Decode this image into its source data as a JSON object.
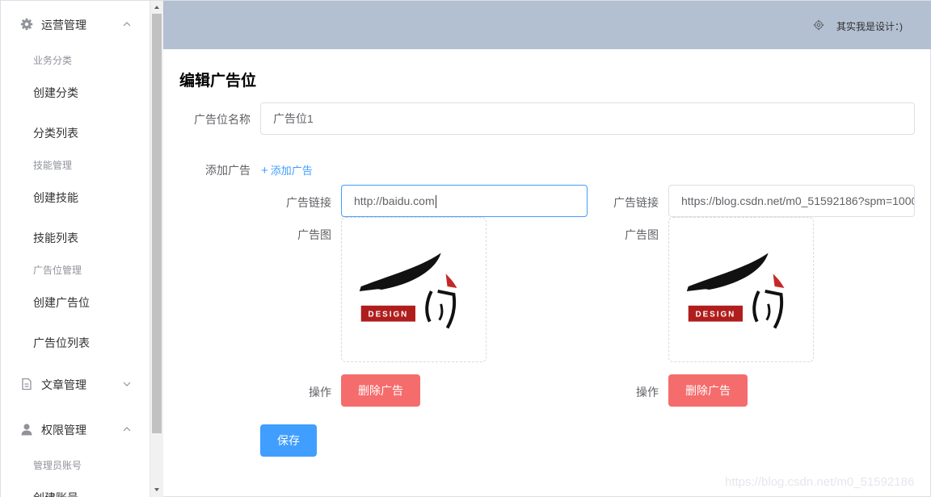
{
  "sidebar": {
    "groups": [
      {
        "title": "运营管理",
        "icon": "gear-icon",
        "expanded": true
      },
      {
        "title": "文章管理",
        "icon": "document-icon",
        "expanded": false
      },
      {
        "title": "权限管理",
        "icon": "user-icon",
        "expanded": true
      }
    ],
    "sections": {
      "business": "业务分类",
      "skills": "技能管理",
      "adpos": "广告位管理",
      "admin": "管理员账号"
    },
    "items": {
      "create_category": "创建分类",
      "category_list": "分类列表",
      "create_skill": "创建技能",
      "skill_list": "技能列表",
      "create_adpos": "创建广告位",
      "adpos_list": "广告位列表",
      "create_account": "创建账号"
    }
  },
  "header": {
    "settings_icon": "settings-icon",
    "username": "其实我是设计：)"
  },
  "main": {
    "title": "编辑广告位",
    "name_label": "广告位名称",
    "name_value": "广告位1",
    "add_label": "添加广告",
    "add_link": "添加广告",
    "ads": [
      {
        "link_label": "广告链接",
        "link_value": "http://baidu.com",
        "image_label": "广告图",
        "image_logo_text": "DESIGN",
        "action_label": "操作",
        "delete_label": "删除广告"
      },
      {
        "link_label": "广告链接",
        "link_value": "https://blog.csdn.net/m0_51592186?spm=1000",
        "image_label": "广告图",
        "image_logo_text": "DESIGN",
        "action_label": "操作",
        "delete_label": "删除广告"
      }
    ],
    "save_label": "保存"
  },
  "watermark": "https://blog.csdn.net/m0_51592186",
  "colors": {
    "header_bg": "#b3c0d1",
    "primary": "#409eff",
    "danger": "#f56c6c"
  }
}
